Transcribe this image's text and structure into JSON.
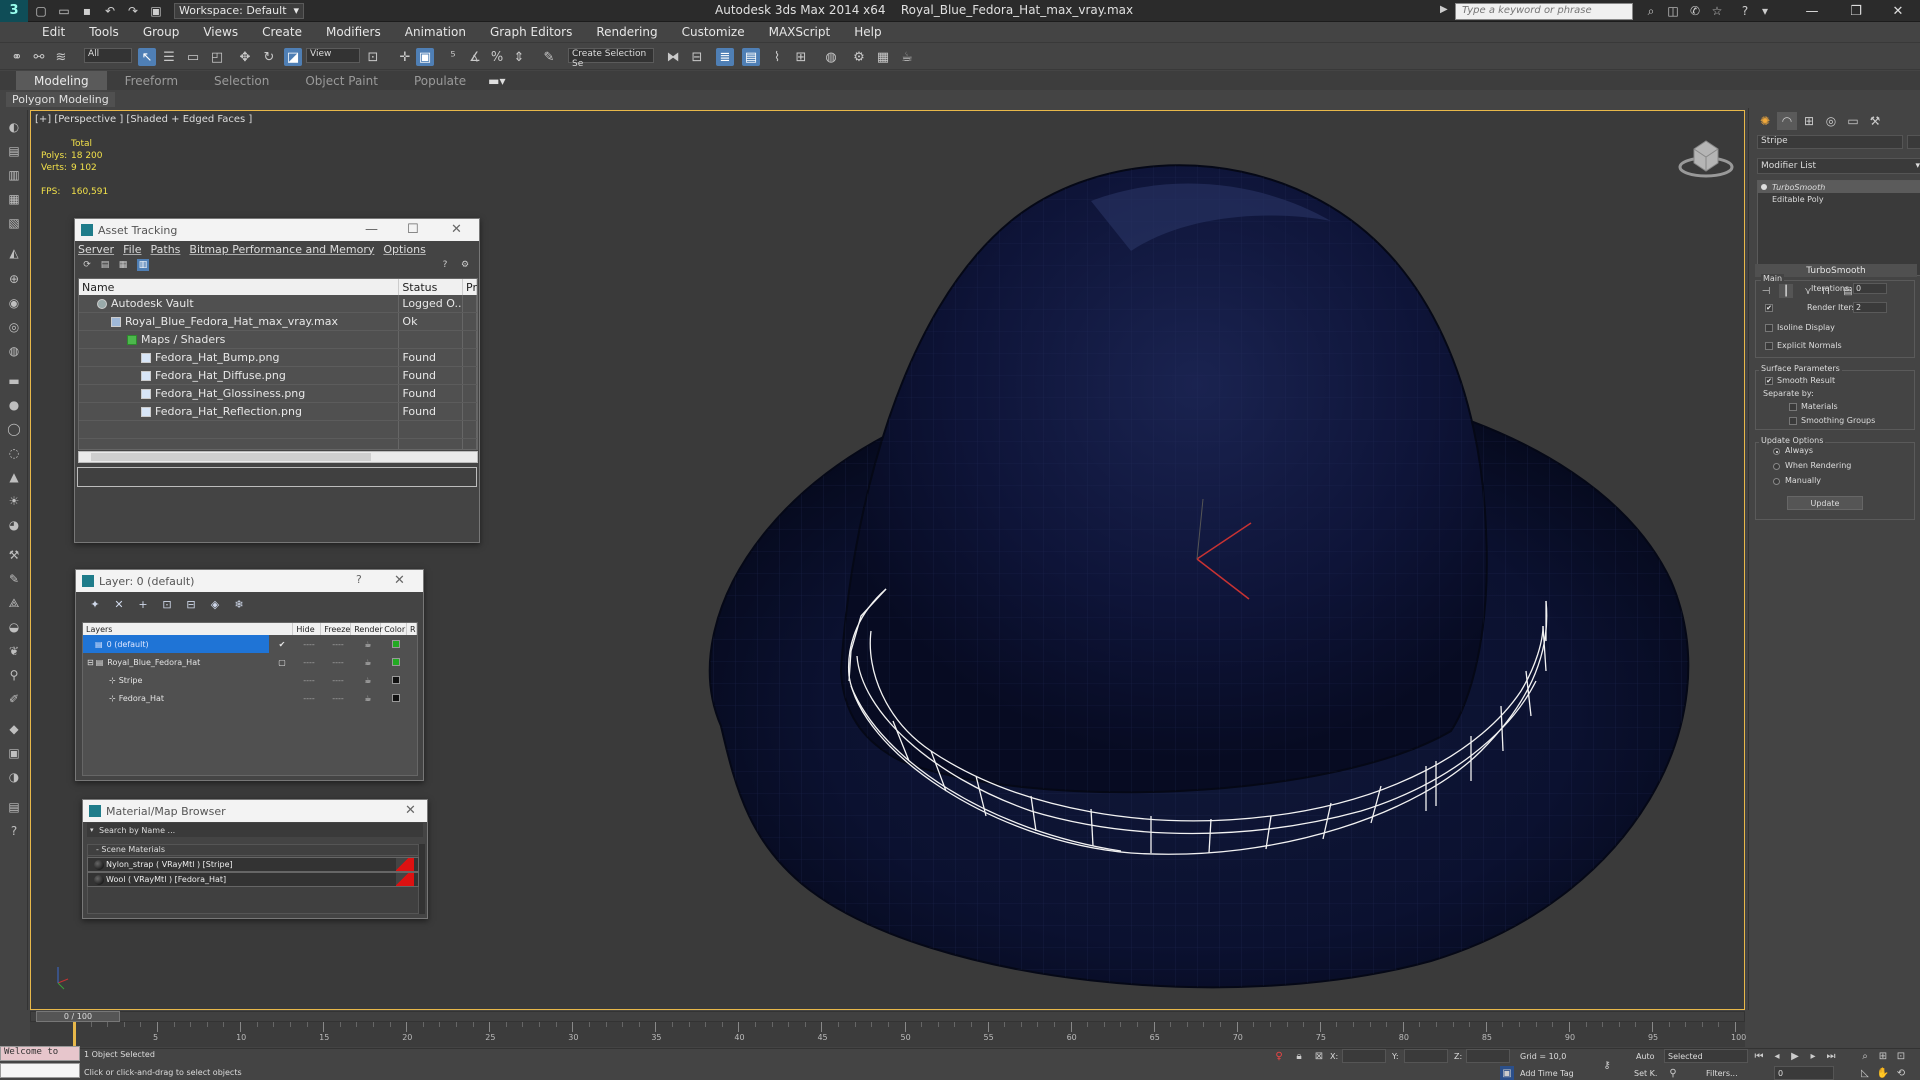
{
  "titlebar": {
    "workspace": "Workspace: Default",
    "app_title": "Autodesk 3ds Max  2014 x64",
    "file_title": "Royal_Blue_Fedora_Hat_max_vray.max",
    "search_placeholder": "Type a keyword or phrase"
  },
  "menus": [
    "Edit",
    "Tools",
    "Group",
    "Views",
    "Create",
    "Modifiers",
    "Animation",
    "Graph Editors",
    "Rendering",
    "Customize",
    "MAXScript",
    "Help"
  ],
  "toolbar": {
    "selection_filter": "All",
    "ref_coord": "View",
    "named_selection": "Create Selection Se"
  },
  "ribbon": {
    "tabs": [
      "Modeling",
      "Freeform",
      "Selection",
      "Object Paint",
      "Populate"
    ],
    "active_tab": "Modeling",
    "panel_label": "Polygon Modeling"
  },
  "viewport": {
    "label": "[+] [Perspective ] [Shaded + Edged Faces ]",
    "stats_total": "Total",
    "polys_label": "Polys:",
    "polys_value": "18 200",
    "verts_label": "Verts:",
    "verts_value": "9 102",
    "fps_label": "FPS:",
    "fps_value": "160,591",
    "colors": {
      "hat": "#0e1436",
      "band_wire": "#ffffff",
      "border_active": "#e8b84a"
    }
  },
  "asset_tracking": {
    "title": "Asset Tracking",
    "menus": [
      "Server",
      "File",
      "Paths",
      "Bitmap Performance and Memory",
      "Options"
    ],
    "columns": [
      "Name",
      "Status",
      "Pr"
    ],
    "rows": [
      {
        "name": "Autodesk Vault",
        "status": "Logged O...",
        "icon": "vault",
        "indent": 0
      },
      {
        "name": "Royal_Blue_Fedora_Hat_max_vray.max",
        "status": "Ok",
        "icon": "max",
        "indent": 1
      },
      {
        "name": "Maps / Shaders",
        "status": "",
        "icon": "folder",
        "indent": 2
      },
      {
        "name": "Fedora_Hat_Bump.png",
        "status": "Found",
        "icon": "image",
        "indent": 3
      },
      {
        "name": "Fedora_Hat_Diffuse.png",
        "status": "Found",
        "icon": "image",
        "indent": 3
      },
      {
        "name": "Fedora_Hat_Glossiness.png",
        "status": "Found",
        "icon": "image",
        "indent": 3
      },
      {
        "name": "Fedora_Hat_Reflection.png",
        "status": "Found",
        "icon": "image",
        "indent": 3
      }
    ]
  },
  "layer_manager": {
    "title": "Layer: 0 (default)",
    "help": "?",
    "columns": [
      "Layers",
      "Hide",
      "Freeze",
      "Render",
      "Color",
      "R"
    ],
    "rows": [
      {
        "name": "0 (default)",
        "color": "#22aa22",
        "selected": true,
        "indent": 0
      },
      {
        "name": "Royal_Blue_Fedora_Hat",
        "color": "#22aa22",
        "selected": false,
        "indent": 0
      },
      {
        "name": "Stripe",
        "color": "#111111",
        "selected": false,
        "indent": 1
      },
      {
        "name": "Fedora_Hat",
        "color": "#111111",
        "selected": false,
        "indent": 1
      }
    ],
    "dash": "----"
  },
  "material_browser": {
    "title": "Material/Map Browser",
    "search_placeholder": "Search by Name ...",
    "group": "- Scene Materials",
    "items": [
      {
        "label": "Nylon_strap  ( VRayMtl ) [Stripe]"
      },
      {
        "label": "Wool  ( VRayMtl ) [Fedora_Hat]"
      }
    ]
  },
  "command_panel": {
    "object_name": "Stripe",
    "modifier_list": "Modifier List",
    "stack": [
      "TurboSmooth",
      "Editable Poly"
    ],
    "rollout": "TurboSmooth",
    "main_group": "Main",
    "iterations_label": "Iterations:",
    "iterations_value": "0",
    "render_iters_label": "Render Iters:",
    "render_iters_value": "2",
    "isoline": "Isoline Display",
    "explicit_normals": "Explicit Normals",
    "surface_group": "Surface Parameters",
    "smooth_result": "Smooth Result",
    "separate_by": "Separate by:",
    "materials": "Materials",
    "smoothing_groups": "Smoothing Groups",
    "update_group": "Update Options",
    "always": "Always",
    "when_rendering": "When Rendering",
    "manually": "Manually",
    "update_button": "Update"
  },
  "timeline": {
    "frame_readout": "0 / 100",
    "ticks": [
      0,
      5,
      10,
      15,
      20,
      25,
      30,
      35,
      40,
      45,
      50,
      55,
      60,
      65,
      70,
      75,
      80,
      85,
      90,
      95,
      100
    ]
  },
  "statusbar": {
    "maxscript": "Welcome to",
    "selection": "1 Object Selected",
    "prompt": "Click or click-and-drag to select objects",
    "x_label": "X:",
    "y_label": "Y:",
    "z_label": "Z:",
    "grid": "Grid = 10,0",
    "add_time_tag": "Add Time Tag",
    "auto": "Auto",
    "selected_dropdown": "Selected",
    "set_key": "Set K.",
    "filters": "Filters...",
    "frame": "0"
  }
}
